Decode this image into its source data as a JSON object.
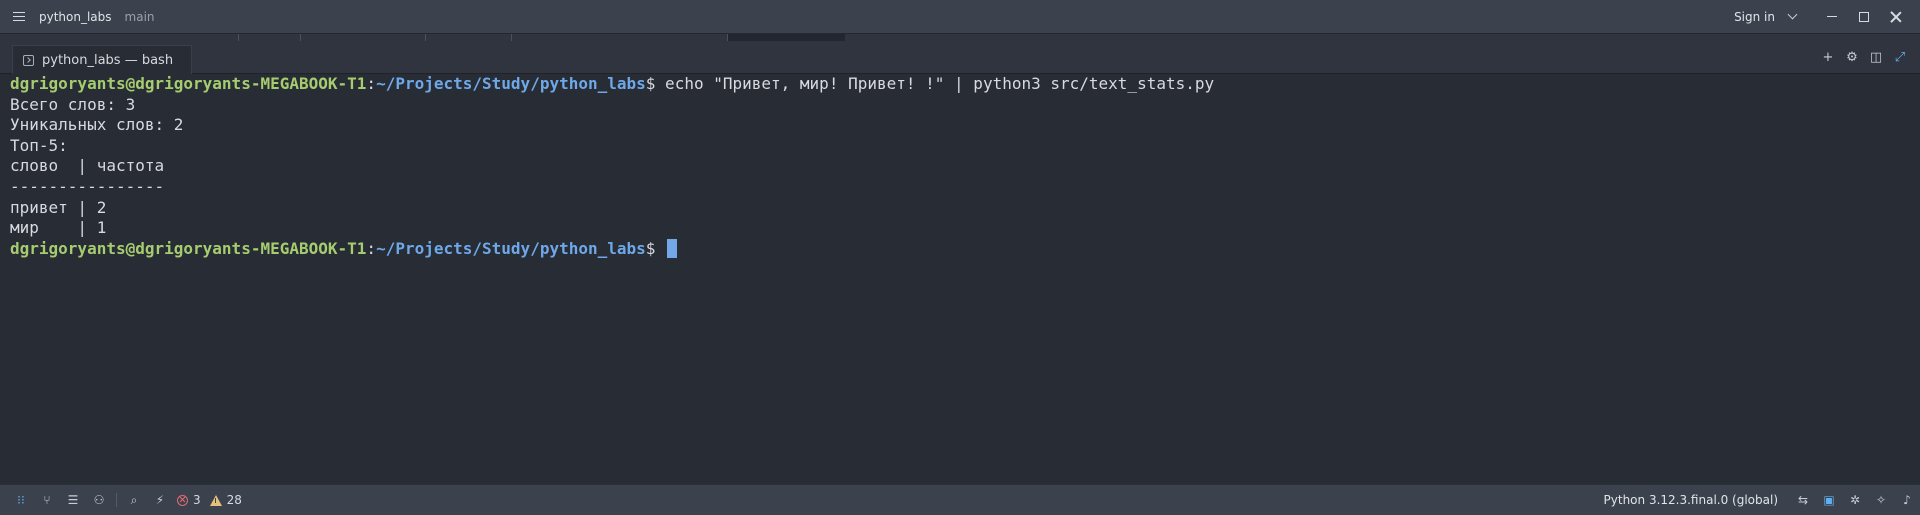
{
  "titlebar": {
    "project": "python_labs",
    "branch": "main",
    "signin": "Sign in"
  },
  "tab": {
    "label": "python_labs — bash"
  },
  "terminal": {
    "user_host": "dgrigoryants@dgrigoryants-MEGABOOK-T1",
    "path": "~/Projects/Study/python_labs",
    "prompt_char": "$",
    "command": " echo \"Привет, мир! Привет! !\" | python3 src/text_stats.py",
    "output": [
      "Всего слов: 3",
      "Уникальных слов: 2",
      "Топ-5:",
      "слово  | частота",
      "----------------",
      "привет | 2",
      "мир    | 1"
    ]
  },
  "statusbar": {
    "errors": "3",
    "warnings": "28",
    "python_env": "Python 3.12.3.final.0 (global)"
  },
  "colors": {
    "prompt_host": "#a6cc70",
    "prompt_path": "#6ea8e8",
    "cursor": "#74a7e8",
    "error": "#e06c75",
    "warning": "#e5c07b"
  }
}
